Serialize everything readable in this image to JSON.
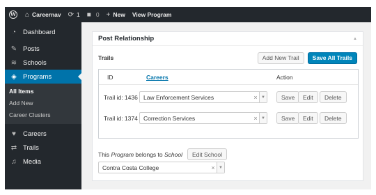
{
  "adminbar": {
    "site_name": "Careernav",
    "updates_count": "1",
    "comments_count": "0",
    "new_label": "New",
    "view_label": "View Program"
  },
  "sidebar": {
    "items": [
      {
        "label": "Dashboard",
        "icon": "dashboard-icon"
      },
      {
        "label": "Posts",
        "icon": "pin-icon"
      },
      {
        "label": "Schools",
        "icon": "school-icon"
      },
      {
        "label": "Programs",
        "icon": "programs-icon"
      },
      {
        "label": "Careers",
        "icon": "heart-icon"
      },
      {
        "label": "Trails",
        "icon": "shuffle-icon"
      },
      {
        "label": "Media",
        "icon": "media-icon"
      }
    ],
    "submenu": [
      {
        "label": "All Items"
      },
      {
        "label": "Add New"
      },
      {
        "label": "Career Clusters"
      }
    ]
  },
  "metabox": {
    "title": "Post Relationship",
    "trails_label": "Trails",
    "add_trail_label": "Add New Trail",
    "save_all_label": "Save All Trails",
    "columns": {
      "id": "ID",
      "careers": "Careers",
      "action": "Action"
    },
    "rows": [
      {
        "id": "Trail id: 1436",
        "career": "Law Enforcement Services",
        "save": "Save",
        "edit": "Edit",
        "delete": "Delete"
      },
      {
        "id": "Trail id: 1374",
        "career": "Correction Services",
        "save": "Save",
        "edit": "Edit",
        "delete": "Delete"
      }
    ],
    "belongs": {
      "prefix": "This",
      "post_type": "Program",
      "middle": "belongs to",
      "target": "School"
    },
    "edit_school_label": "Edit School",
    "school_value": "Contra Costa College"
  },
  "colors": {
    "accent": "#0073aa",
    "primary_button": "#0085ba",
    "sidebar_bg": "#23282d"
  }
}
